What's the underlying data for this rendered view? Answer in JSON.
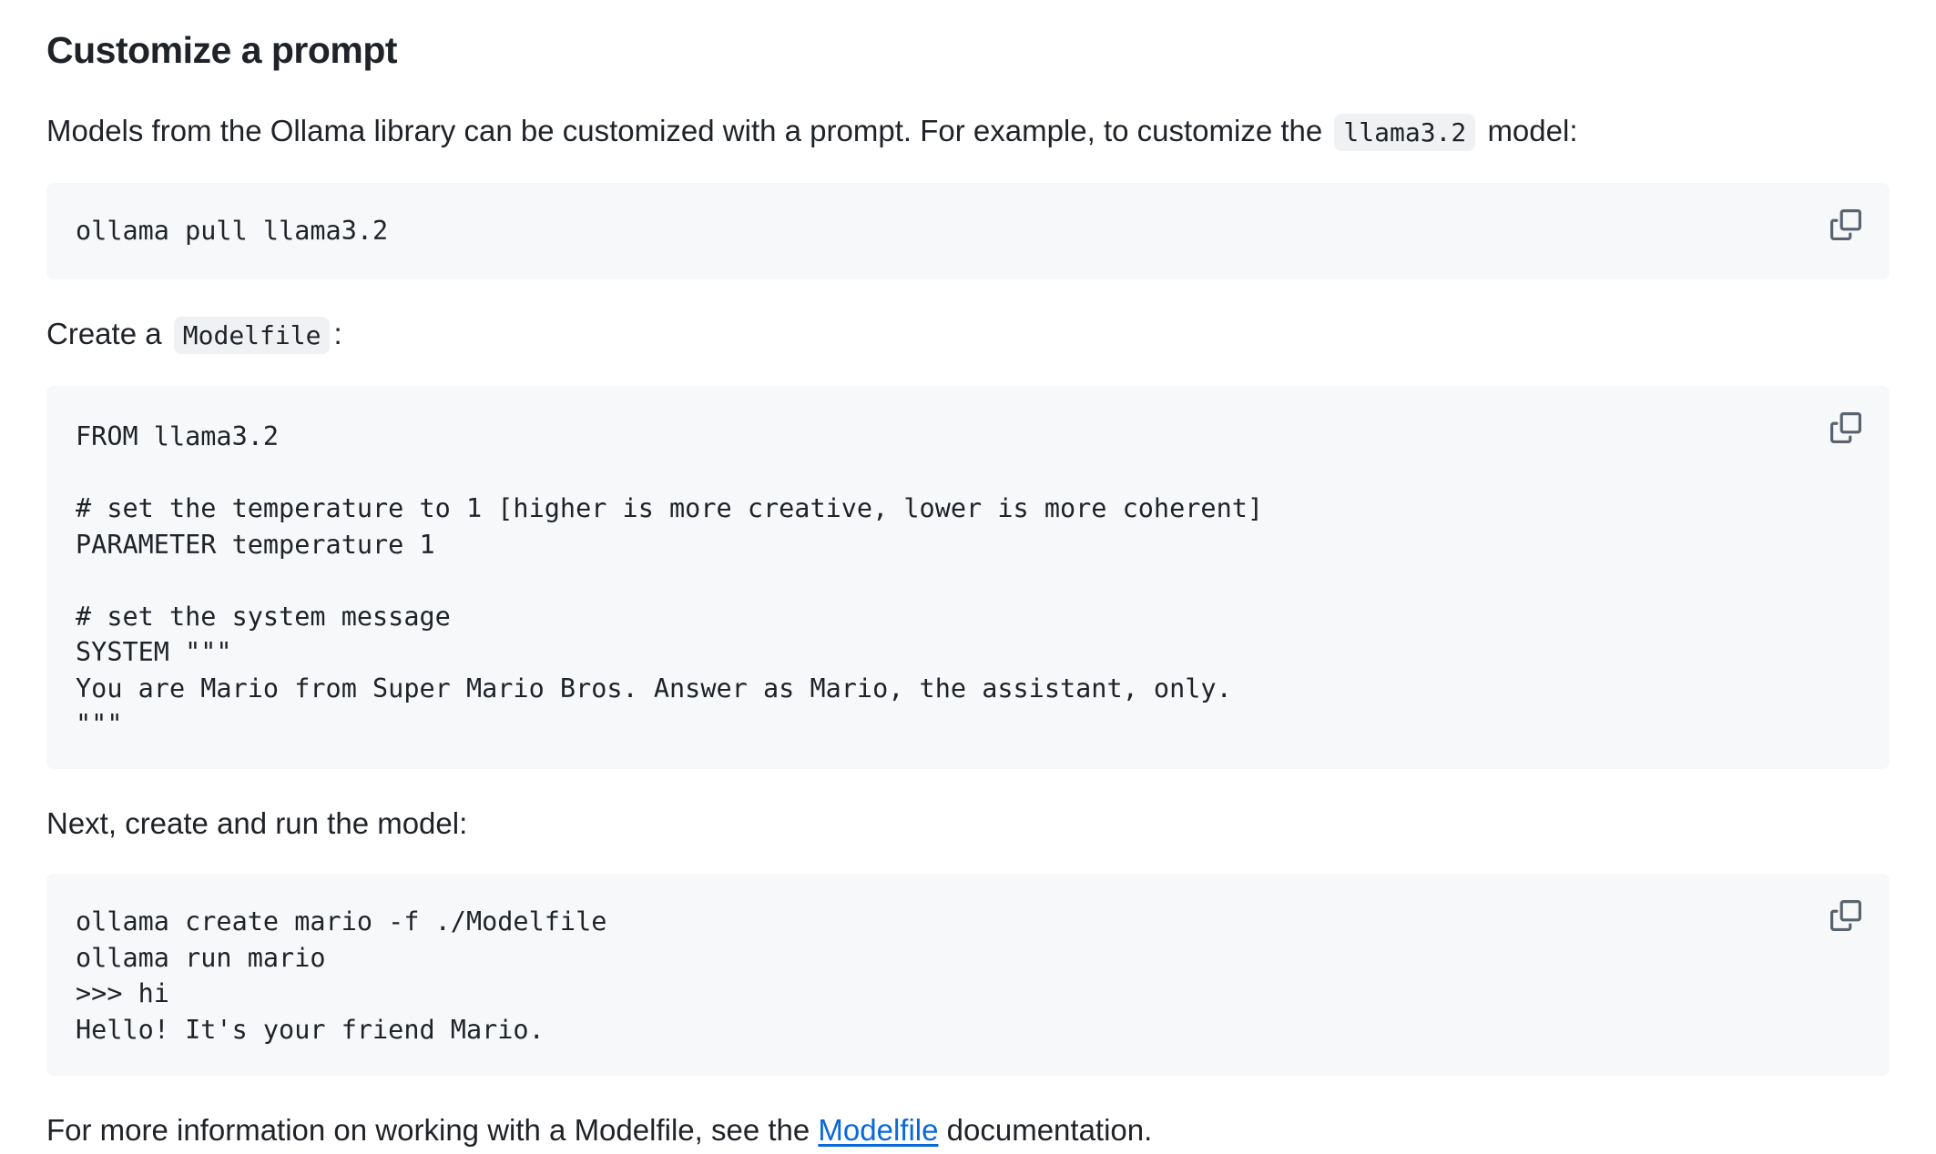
{
  "heading": "Customize a prompt",
  "intro": {
    "before": "Models from the Ollama library can be customized with a prompt. For example, to customize the",
    "code": "llama3.2",
    "after": "model:"
  },
  "code_blocks": [
    {
      "lines": "ollama pull llama3.2"
    },
    {
      "lines": "FROM llama3.2\n\n# set the temperature to 1 [higher is more creative, lower is more coherent]\nPARAMETER temperature 1\n\n# set the system message\nSYSTEM \"\"\"\nYou are Mario from Super Mario Bros. Answer as Mario, the assistant, only.\n\"\"\""
    },
    {
      "lines": "ollama create mario -f ./Modelfile\nollama run mario\n>>> hi\nHello! It's your friend Mario."
    }
  ],
  "create_para": {
    "before": "Create a",
    "code": "Modelfile",
    "after": ":"
  },
  "next_para": "Next, create and run the model:",
  "footer_para": {
    "before": "For more information on working with a Modelfile, see the",
    "link": "Modelfile",
    "after": "documentation."
  },
  "icons": {
    "copy": "copy-icon"
  },
  "colors": {
    "link": "#0969da",
    "code_bg": "#f6f8fa",
    "inline_code_bg": "#eff1f3"
  }
}
